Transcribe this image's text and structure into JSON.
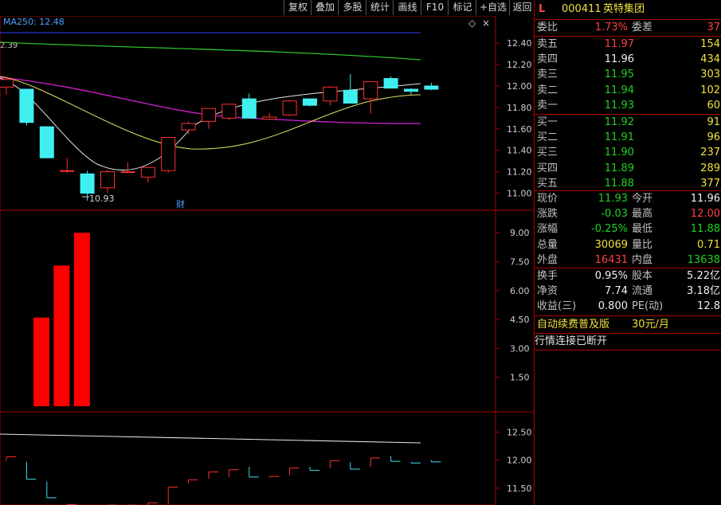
{
  "toolbar": {
    "items": [
      "复权",
      "叠加",
      "多股",
      "统计",
      "画线",
      "F10",
      "标记",
      "+自选",
      "返回"
    ]
  },
  "ma_label": "MA250: 12.48",
  "left_price": "2.39",
  "low_marker": "10.93",
  "event_badge": "财",
  "top_axis": [
    "12.40",
    "12.20",
    "12.00",
    "11.80",
    "11.60",
    "11.40",
    "11.20",
    "11.00"
  ],
  "vol_axis": [
    "9.00",
    "7.50",
    "6.00",
    "4.50",
    "3.00",
    "1.50"
  ],
  "bot_axis": [
    "12.50",
    "12.00",
    "11.50"
  ],
  "header": {
    "flag": "L",
    "code": "000411",
    "name": "英特集团"
  },
  "weibi": {
    "label": "委比",
    "value": "1.73%",
    "label2": "委差",
    "value2": "37"
  },
  "sells": [
    {
      "label": "卖五",
      "price": "11.97",
      "vol": "154"
    },
    {
      "label": "卖四",
      "price": "11.96",
      "vol": "434"
    },
    {
      "label": "卖三",
      "price": "11.95",
      "vol": "303"
    },
    {
      "label": "卖二",
      "price": "11.94",
      "vol": "102"
    },
    {
      "label": "卖一",
      "price": "11.93",
      "vol": "60"
    }
  ],
  "buys": [
    {
      "label": "买一",
      "price": "11.92",
      "vol": "91"
    },
    {
      "label": "买二",
      "price": "11.91",
      "vol": "96"
    },
    {
      "label": "买三",
      "price": "11.90",
      "vol": "237"
    },
    {
      "label": "买四",
      "price": "11.89",
      "vol": "289"
    },
    {
      "label": "买五",
      "price": "11.88",
      "vol": "377"
    }
  ],
  "stats": [
    {
      "l1": "现价",
      "v1": "11.93",
      "l2": "今开",
      "v2": "11.96"
    },
    {
      "l1": "涨跌",
      "v1": "-0.03",
      "l2": "最高",
      "v2": "12.00"
    },
    {
      "l1": "涨幅",
      "v1": "-0.25%",
      "l2": "最低",
      "v2": "11.88"
    },
    {
      "l1": "总量",
      "v1": "30069",
      "l2": "量比",
      "v2": "0.71"
    },
    {
      "l1": "外盘",
      "v1": "16431",
      "l2": "内盘",
      "v2": "13638"
    }
  ],
  "fin": [
    {
      "l1": "换手",
      "v1": "0.95%",
      "l2": "股本",
      "v2": "5.22亿"
    },
    {
      "l1": "净资",
      "v1": "7.74",
      "l2": "流通",
      "v2": "3.18亿"
    },
    {
      "l1": "收益(三)",
      "v1": "0.800",
      "l2": "PE(动)",
      "v2": "12.8"
    }
  ],
  "promo": {
    "text": "自动续费普及版",
    "price": "30元/月"
  },
  "status": "行情连接已断开",
  "chart_data": {
    "type": "candlestick",
    "candles": [
      {
        "o": 11.99,
        "h": 12.09,
        "l": 11.92,
        "c": 12.06
      },
      {
        "o": 11.97,
        "h": 11.97,
        "l": 11.63,
        "c": 11.66
      },
      {
        "o": 11.62,
        "h": 11.62,
        "l": 11.33,
        "c": 11.33
      },
      {
        "o": 11.21,
        "h": 11.33,
        "l": 11.19,
        "c": 11.21
      },
      {
        "o": 11.18,
        "h": 11.21,
        "l": 10.93,
        "c": 11.0
      },
      {
        "o": 11.05,
        "h": 11.22,
        "l": 11.0,
        "c": 11.2
      },
      {
        "o": 11.2,
        "h": 11.29,
        "l": 11.19,
        "c": 11.2
      },
      {
        "o": 11.15,
        "h": 11.23,
        "l": 11.1,
        "c": 11.24
      },
      {
        "o": 11.21,
        "h": 11.52,
        "l": 11.19,
        "c": 11.52
      },
      {
        "o": 11.59,
        "h": 11.67,
        "l": 11.55,
        "c": 11.65
      },
      {
        "o": 11.67,
        "h": 11.79,
        "l": 11.6,
        "c": 11.79
      },
      {
        "o": 11.7,
        "h": 11.83,
        "l": 11.68,
        "c": 11.83
      },
      {
        "o": 11.88,
        "h": 11.93,
        "l": 11.7,
        "c": 11.7
      },
      {
        "o": 11.69,
        "h": 11.75,
        "l": 11.68,
        "c": 11.71
      },
      {
        "o": 11.73,
        "h": 11.87,
        "l": 11.72,
        "c": 11.86
      },
      {
        "o": 11.88,
        "h": 11.88,
        "l": 11.81,
        "c": 11.82
      },
      {
        "o": 11.86,
        "h": 12.0,
        "l": 11.82,
        "c": 11.99
      },
      {
        "o": 11.96,
        "h": 12.11,
        "l": 11.84,
        "c": 11.84
      },
      {
        "o": 11.88,
        "h": 12.04,
        "l": 11.74,
        "c": 12.04
      },
      {
        "o": 12.07,
        "h": 12.09,
        "l": 11.98,
        "c": 11.98
      },
      {
        "o": 11.97,
        "h": 11.98,
        "l": 11.92,
        "c": 11.95
      },
      {
        "o": 12.0,
        "h": 12.03,
        "l": 11.96,
        "c": 11.97
      }
    ],
    "volume": [
      0,
      0,
      0,
      0,
      0,
      0,
      0,
      0,
      0,
      0,
      0,
      0,
      0,
      0,
      0,
      0,
      0,
      0,
      0,
      0,
      0,
      0
    ],
    "volume_bars": [
      4.6,
      7.3,
      9.0
    ],
    "price_range": [
      10.87,
      12.52
    ],
    "vol_range": [
      0,
      10
    ]
  }
}
